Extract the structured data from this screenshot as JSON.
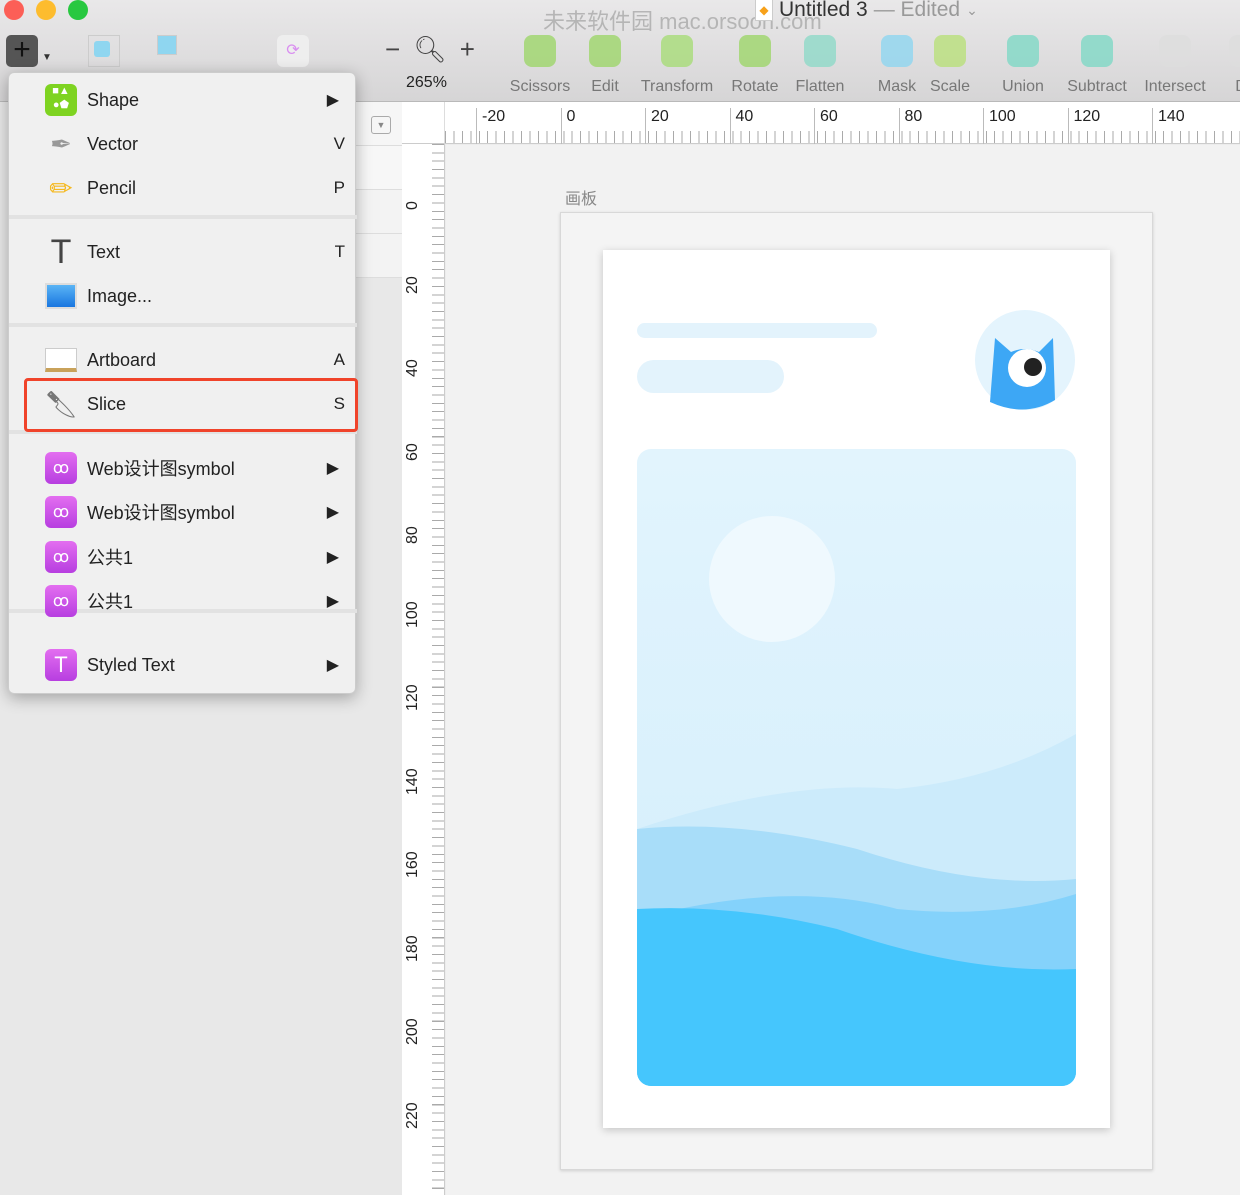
{
  "window": {
    "title": "Untitled 3",
    "status": "— Edited"
  },
  "watermark": {
    "text": "未来软件园 mac.orsoon.com"
  },
  "toolbar": {
    "zoom_level": "265%",
    "zoom_minus": "−",
    "zoom_plus": "+",
    "tools": [
      {
        "label": "Scissors",
        "icon": "scissors-icon"
      },
      {
        "label": "Edit",
        "icon": "edit-icon"
      },
      {
        "label": "Transform",
        "icon": "transform-icon"
      },
      {
        "label": "Rotate",
        "icon": "rotate-icon"
      },
      {
        "label": "Flatten",
        "icon": "flatten-icon"
      },
      {
        "label": "Mask",
        "icon": "mask-icon"
      },
      {
        "label": "Scale",
        "icon": "scale-icon"
      },
      {
        "label": "Union",
        "icon": "union-icon"
      },
      {
        "label": "Subtract",
        "icon": "subtract-icon"
      },
      {
        "label": "Intersect",
        "icon": "intersect-icon"
      },
      {
        "label": "Dif",
        "icon": "difference-icon"
      }
    ]
  },
  "insert_menu": {
    "items": [
      {
        "label": "Shape",
        "shortcut": "",
        "submenu": true,
        "icon": "shape-icon"
      },
      {
        "label": "Vector",
        "shortcut": "V",
        "icon": "vector-pen-icon"
      },
      {
        "label": "Pencil",
        "shortcut": "P",
        "icon": "pencil-icon"
      },
      {
        "label": "Text",
        "shortcut": "T",
        "icon": "text-icon"
      },
      {
        "label": "Image...",
        "shortcut": "",
        "icon": "image-icon"
      },
      {
        "label": "Artboard",
        "shortcut": "A",
        "icon": "artboard-icon"
      },
      {
        "label": "Slice",
        "shortcut": "S",
        "icon": "slice-knife-icon",
        "highlighted": true
      },
      {
        "label": "Web设计图symbol",
        "submenu": true,
        "icon": "symbol-icon"
      },
      {
        "label": "Web设计图symbol",
        "submenu": true,
        "icon": "symbol-icon"
      },
      {
        "label": "公共1",
        "submenu": true,
        "icon": "symbol-icon"
      },
      {
        "label": "公共1",
        "submenu": true,
        "icon": "symbol-icon"
      },
      {
        "label": "Styled Text",
        "submenu": true,
        "icon": "styled-text-icon"
      }
    ],
    "arrow": "▶"
  },
  "rulers": {
    "horizontal": [
      "-20",
      "0",
      "20",
      "40",
      "60",
      "80",
      "100",
      "120",
      "140"
    ],
    "vertical": [
      "0",
      "20",
      "40",
      "60",
      "80",
      "100",
      "120",
      "140",
      "160",
      "180",
      "200",
      "220"
    ]
  },
  "artboard": {
    "name": "画板"
  },
  "colors": {
    "highlight": "#f0432a",
    "accent_blue": "#3da7f5",
    "wave": "#45c6fd"
  }
}
